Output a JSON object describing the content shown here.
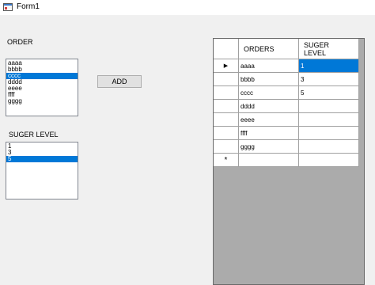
{
  "window": {
    "title": "Form1"
  },
  "order_label": "ORDER",
  "sugar_label": "SUGER LEVEL",
  "add_button": "ADD",
  "orders_list": [
    {
      "text": "aaaa",
      "selected": false
    },
    {
      "text": "bbbb",
      "selected": false
    },
    {
      "text": "cccc",
      "selected": true
    },
    {
      "text": "dddd",
      "selected": false
    },
    {
      "text": "eeee",
      "selected": false
    },
    {
      "text": "ffff",
      "selected": false
    },
    {
      "text": "gggg",
      "selected": false
    }
  ],
  "sugar_list": [
    {
      "text": "1",
      "selected": false
    },
    {
      "text": "3",
      "selected": false
    },
    {
      "text": "5",
      "selected": true
    }
  ],
  "grid": {
    "columns": [
      "ORDERS",
      "SUGER\nLEVEL"
    ],
    "rows": [
      {
        "marker": "current-row-arrow-icon",
        "order": "aaaa",
        "sugar": "1"
      },
      {
        "marker": "",
        "order": "bbbb",
        "sugar": "3"
      },
      {
        "marker": "",
        "order": "cccc",
        "sugar": "5"
      },
      {
        "marker": "",
        "order": "dddd",
        "sugar": ""
      },
      {
        "marker": "",
        "order": "eeee",
        "sugar": ""
      },
      {
        "marker": "",
        "order": "ffff",
        "sugar": ""
      },
      {
        "marker": "",
        "order": "gggg",
        "sugar": ""
      },
      {
        "marker": "new-row-asterisk-icon",
        "order": "",
        "sugar": ""
      }
    ],
    "selected_cell": {
      "row": 0,
      "column": 1
    }
  },
  "colors": {
    "selection": "#0078d7",
    "grid_background": "#ababab",
    "form_background": "#f0f0f0"
  }
}
